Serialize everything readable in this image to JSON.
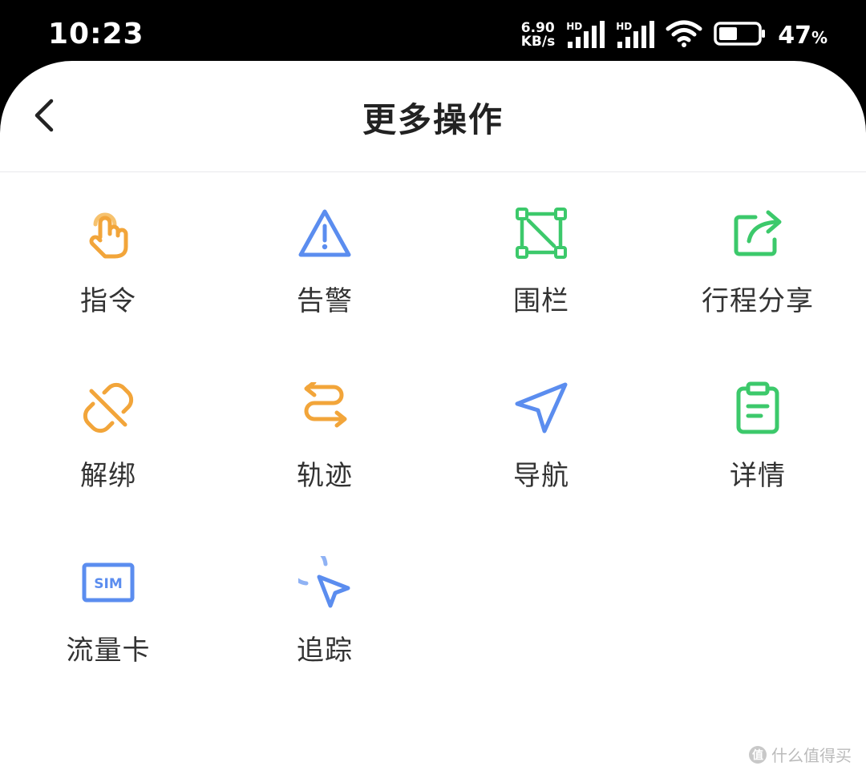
{
  "status_bar": {
    "time": "10:23",
    "net_speed_value": "6.90",
    "net_speed_unit": "KB/s",
    "sim1_label": "HD",
    "sim2_label": "HD",
    "battery_value": "47",
    "battery_unit": "%",
    "battery_level": 0.47,
    "icons": [
      "signal-icon",
      "signal-icon",
      "wifi-icon",
      "battery-icon"
    ]
  },
  "header": {
    "title": "更多操作",
    "back_icon": "chevron-left-icon"
  },
  "actions": [
    {
      "id": "command",
      "label": "指令",
      "icon": "touch-finger-icon",
      "color": "#f2a53a"
    },
    {
      "id": "alarm",
      "label": "告警",
      "icon": "warning-triangle-icon",
      "color": "#5b8def"
    },
    {
      "id": "fence",
      "label": "围栏",
      "icon": "geofence-icon",
      "color": "#3cc96b"
    },
    {
      "id": "trip-share",
      "label": "行程分享",
      "icon": "share-icon",
      "color": "#3cc96b"
    },
    {
      "id": "unbind",
      "label": "解绑",
      "icon": "unlink-icon",
      "color": "#f2a53a"
    },
    {
      "id": "track",
      "label": "轨迹",
      "icon": "swap-arrows-icon",
      "color": "#f2a53a"
    },
    {
      "id": "navigate",
      "label": "导航",
      "icon": "navigation-arrow-icon",
      "color": "#5b8def"
    },
    {
      "id": "details",
      "label": "详情",
      "icon": "clipboard-icon",
      "color": "#3cc96b"
    },
    {
      "id": "data-card",
      "label": "流量卡",
      "icon": "sim-card-icon",
      "color": "#5b8def",
      "icon_text": "SIM"
    },
    {
      "id": "follow",
      "label": "追踪",
      "icon": "pointer-click-icon",
      "color": "#5b8def"
    }
  ],
  "watermark": {
    "icon_text": "值",
    "text": "什么值得买"
  }
}
